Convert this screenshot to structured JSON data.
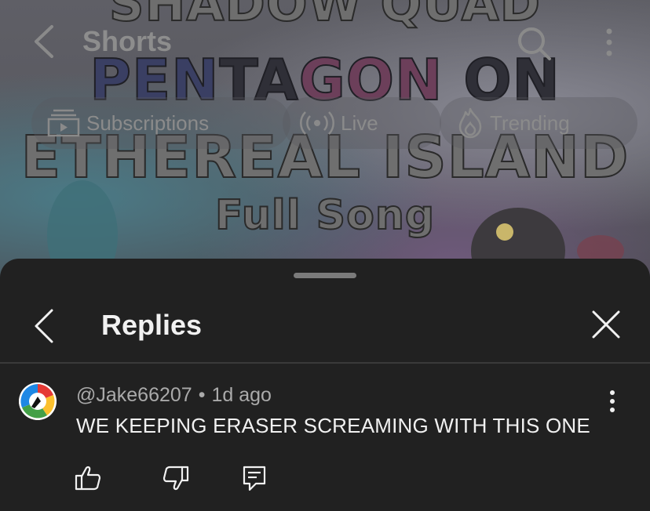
{
  "background": {
    "app_bar": {
      "title": "Shorts",
      "icons": [
        "chevron-left-icon",
        "search-icon",
        "more-vertical-icon"
      ]
    },
    "chips": [
      {
        "label": "Subscriptions",
        "icon": "subscriptions-icon"
      },
      {
        "label": "Live",
        "icon": "live-icon"
      },
      {
        "label": "Trending",
        "icon": "trending-icon"
      }
    ],
    "thumbnail_text": {
      "line1": "SHADOW QUAD",
      "line2_a": "PEN",
      "line2_b": "TA",
      "line2_c": "GON",
      "line2_d": " ON",
      "line3": "ETHEREAL ISLAND",
      "line4": "Full Song"
    }
  },
  "sheet": {
    "title": "Replies",
    "icons": [
      "chevron-left-icon",
      "close-icon"
    ]
  },
  "comment": {
    "author": "@Jake66207",
    "separator": "•",
    "time": "1d ago",
    "text": "WE KEEPING ERASER SCREAMING WITH THIS ONE",
    "actions": [
      "thumbs-up-icon",
      "thumbs-down-icon",
      "reply-icon"
    ]
  },
  "colors": {
    "sheet_bg": "#212121",
    "primary_text": "#f1f1f1",
    "secondary_text": "#aaaaaa"
  }
}
